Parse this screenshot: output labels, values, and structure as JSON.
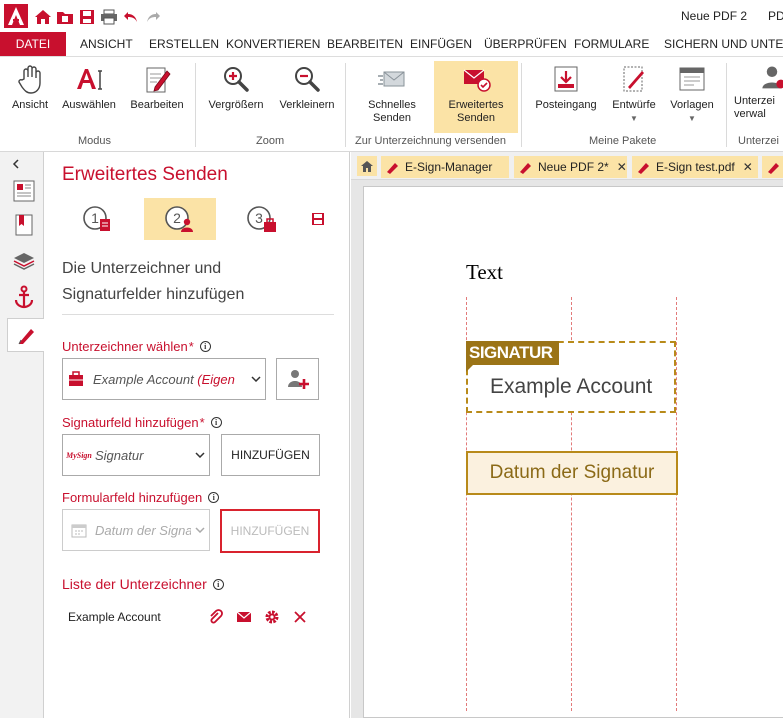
{
  "window": {
    "title": "Neue PDF 2",
    "title_suffix": "PD"
  },
  "menu": {
    "tabs": [
      {
        "label": "DATEI"
      },
      {
        "label": "ANSICHT"
      },
      {
        "label": "ERSTELLEN"
      },
      {
        "label": "KONVERTIEREN"
      },
      {
        "label": "BEARBEITEN"
      },
      {
        "label": "EINFÜGEN"
      },
      {
        "label": "ÜBERPRÜFEN"
      },
      {
        "label": "FORMULARE"
      },
      {
        "label": "SICHERN UND UNTERZ"
      }
    ]
  },
  "ribbon": {
    "buttons": [
      {
        "label": "Ansicht"
      },
      {
        "label": "Auswählen"
      },
      {
        "label": "Bearbeiten"
      },
      {
        "label": "Vergrößern"
      },
      {
        "label": "Verkleinern"
      },
      {
        "label": "Schnelles\nSenden"
      },
      {
        "label": "Erweitertes\nSenden"
      },
      {
        "label": "Posteingang"
      },
      {
        "label": "Entwürfe"
      },
      {
        "label": "Vorlagen"
      },
      {
        "label": "Unterzei\nverwal"
      }
    ],
    "groups": [
      {
        "label": "Modus"
      },
      {
        "label": "Zoom"
      },
      {
        "label": "Zur Unterzeichnung versenden"
      },
      {
        "label": "Meine Pakete"
      },
      {
        "label": "Unterzei"
      }
    ]
  },
  "panel": {
    "title": "Erweitertes Senden",
    "subtitle_line1": "Die Unterzeichner und",
    "subtitle_line2": "Signaturfelder hinzufügen",
    "signer_section": {
      "label": "Unterzeichner wählen",
      "required_mark": "*",
      "value_text": "Example Account ",
      "value_suffix": "(Eigen"
    },
    "sigfield_section": {
      "label": "Signaturfeld hinzufügen",
      "required_mark": "*",
      "value": "Signatur",
      "icon_text": "MySign",
      "button": "HINZUFÜGEN"
    },
    "formfield_section": {
      "label": "Formularfeld hinzufügen",
      "value": "Datum der Signa",
      "button": "HINZUFÜGEN"
    },
    "signers_list": {
      "label": "Liste der Unterzeichner",
      "items": [
        {
          "name": "Example Account"
        }
      ]
    }
  },
  "doc": {
    "tabs": [
      {
        "label": "E-Sign-Manager",
        "closable": false
      },
      {
        "label": "Neue PDF 2*",
        "closable": true
      },
      {
        "label": "E-Sign test.pdf",
        "closable": true
      }
    ],
    "close_glyph": "✕",
    "text": "Text",
    "signature_tag": "SIGNATUR",
    "signature_name": "Example Account",
    "date_field": "Datum der Signatur"
  },
  "colors": {
    "brand_red": "#c8102e",
    "highlight": "#fbe3a6",
    "field_gold": "#b88a1a"
  }
}
